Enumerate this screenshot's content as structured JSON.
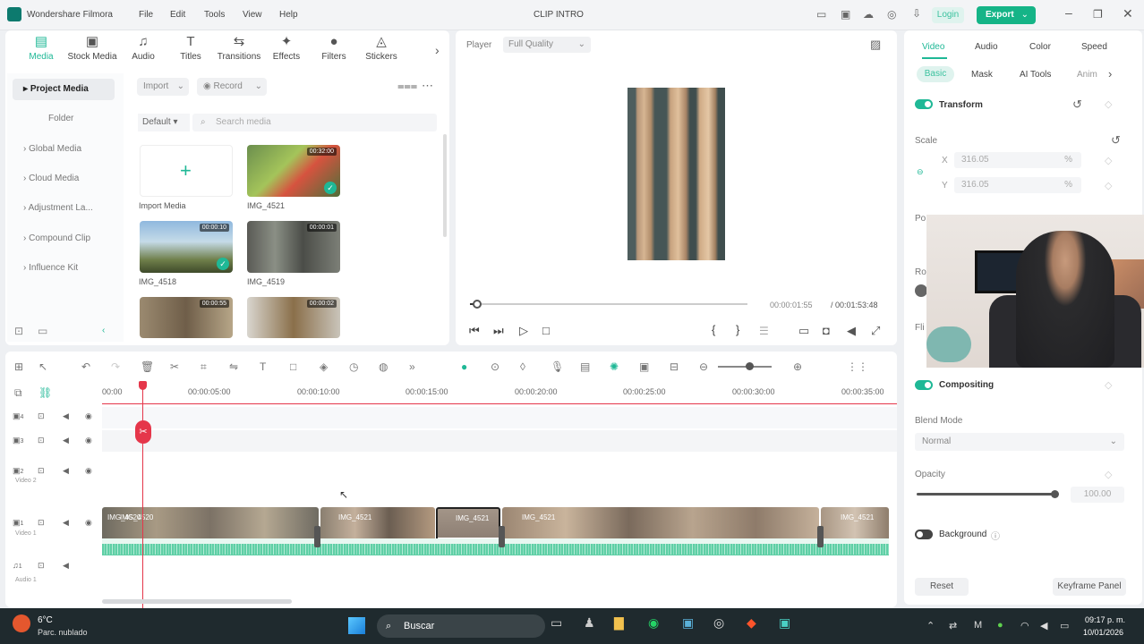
{
  "app": {
    "name": "Wondershare Filmora",
    "project_title": "CLIP INTRO",
    "menu": [
      "File",
      "Edit",
      "Tools",
      "View",
      "Help"
    ],
    "login": "Login",
    "export": "Export"
  },
  "media_tabs": [
    "Media",
    "Stock Media",
    "Audio",
    "Titles",
    "Transitions",
    "Effects",
    "Filters",
    "Stickers"
  ],
  "sidebar": {
    "items": [
      "Project Media",
      "Folder",
      "Global Media",
      "Cloud Media",
      "Adjustment La...",
      "Compound Clip",
      "Influence Kit"
    ]
  },
  "media_toolbar": {
    "import": "Import",
    "record": "Record",
    "sort": "Default",
    "search_placeholder": "Search media"
  },
  "media_items": [
    {
      "label": "Import Media"
    },
    {
      "label": "IMG_4521",
      "duration": "00:32:00"
    },
    {
      "label": "IMG_4518",
      "duration": "00:00:10"
    },
    {
      "label": "IMG_4519",
      "duration": "00:00:01"
    },
    {
      "label": "",
      "duration": "00:00:55"
    },
    {
      "label": "",
      "duration": "00:00:02"
    }
  ],
  "player": {
    "label": "Player",
    "quality": "Full Quality",
    "current_time": "00:00:01:55",
    "total_time": "/ 00:01:53:48",
    "progress": 0.03
  },
  "right_panel": {
    "tabs": [
      "Video",
      "Audio",
      "Color",
      "Speed"
    ],
    "subtabs": [
      "Basic",
      "Mask",
      "AI Tools",
      "Anim"
    ],
    "transform": "Transform",
    "scale": "Scale",
    "scale_x_label": "X",
    "scale_x": "316.05",
    "scale_y_label": "Y",
    "scale_y": "316.05",
    "unit": "%",
    "partial_labels": [
      "Po",
      "Ro",
      "Fli"
    ],
    "compositing": "Compositing",
    "blend_mode_label": "Blend Mode",
    "blend_mode": "Normal",
    "opacity_label": "Opacity",
    "opacity": "100.00",
    "opacity_level": 1.0,
    "background": "Background",
    "reset": "Reset",
    "keyframe_panel": "Keyframe Panel"
  },
  "timeline": {
    "ruler": [
      "00:00",
      "00:00:05:00",
      "00:00:10:00",
      "00:00:15:00",
      "00:00:20:00",
      "00:00:25:00",
      "00:00:30:00",
      "00:00:35:00"
    ],
    "tracks": [
      {
        "num": "4",
        "name": ""
      },
      {
        "num": "3",
        "name": ""
      },
      {
        "num": "2",
        "name": "Video 2"
      },
      {
        "num": "1",
        "name": "Video 1"
      },
      {
        "num": "1",
        "name": "Audio 1"
      }
    ],
    "clips": [
      "IMG_4520",
      "IMG_4521",
      "IMG_4521",
      "IMG_4521",
      "IMG_4521"
    ]
  },
  "taskbar": {
    "temp": "6°C",
    "weather": "Parc. nublado",
    "search": "Buscar",
    "time": "09:17 p. m.",
    "date": "10/01/2026"
  },
  "colors": {
    "accent": "#1fb896",
    "export": "#15b487",
    "playhead": "#e5364a",
    "clip_video": "#8a7a68",
    "audio_wave": "#5fcfa6"
  }
}
